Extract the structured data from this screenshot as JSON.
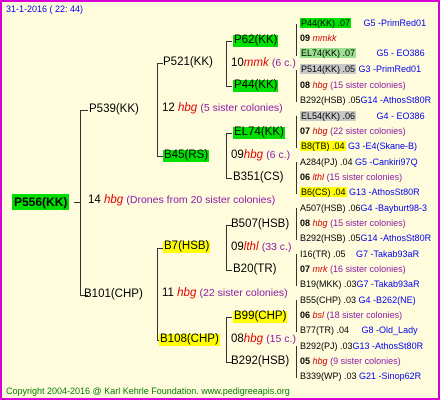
{
  "header": "31-1-2016 ( 22: 44)",
  "footer": "Copyright 2004-2016 @ Karl Kehrle Foundation.   www.pedigreeapis.org",
  "root": {
    "code": "P556(KK)",
    "num": "14",
    "breed": "hbg",
    "note": "(Drones from 20 sister colonies)"
  },
  "gen1": [
    {
      "code": "P539(KK)",
      "num": "12",
      "breed": "hbg",
      "note": "(5 sister colonies)"
    },
    {
      "code": "B101(CHP)",
      "num": "11",
      "breed": "hbg",
      "note": "(22 sister colonies)"
    }
  ],
  "gen2": [
    {
      "code": "P521(KK)",
      "num": "10",
      "breed": "mmk",
      "note": "(6 c.)"
    },
    {
      "code": "B45(RS)",
      "num": "09",
      "breed": "hbg",
      "note": "(6 c.)"
    },
    {
      "code": "B7(HSB)",
      "num": "09",
      "breed": "lthl",
      "note": "(33 c.)"
    },
    {
      "code": "B108(CHP)",
      "num": "08",
      "breed": "hbg",
      "note": "(15 c.)"
    }
  ],
  "gen3": [
    "P62(KK)",
    "P44(KK)",
    "EL74(KK)",
    "B351(CS)",
    "B507(HSB)",
    "B20(TR)",
    "B99(CHP)",
    "B292(HSB)"
  ],
  "gen4": [
    {
      "code": "P44(KK) .07",
      "ref": "G5 -PrimRed01"
    },
    {
      "num": "09",
      "breed": "mmkk",
      "note": ""
    },
    {
      "code": "EL74(KK) .07",
      "ref": "G5 - EO386"
    },
    {
      "code": "P514(KK) .05",
      "ref": "G3 -PrimRed01"
    },
    {
      "num": "08",
      "breed": "hbg",
      "note": "(15 sister colonies)"
    },
    {
      "code": "B292(HSB) .05",
      "ref": "G14 -AthosSt80R"
    },
    {
      "code": "EL54(KK) .06",
      "ref": "G4 - EO386"
    },
    {
      "num": "07",
      "breed": "hbg",
      "note": "(22 sister colonies)"
    },
    {
      "code": "B8(TB) .04",
      "ref": "G3 -E4(Skane-B)"
    },
    {
      "code": "A284(PJ) .04",
      "ref": "G5 -Cankiri97Q"
    },
    {
      "num": "06",
      "breed": "lthl",
      "note": "(15 sister colonies)"
    },
    {
      "code": "B6(CS) .04",
      "ref": "G13 -AthosSt80R"
    },
    {
      "code": "A507(HSB) .06",
      "ref": "G4 -Bayburt98-3"
    },
    {
      "num": "08",
      "breed": "hbg",
      "note": "(15 sister colonies)"
    },
    {
      "code": "B292(HSB) .05",
      "ref": "G14 -AthosSt80R"
    },
    {
      "code": "I16(TR) .05",
      "ref": "G7 -Takab93aR"
    },
    {
      "num": "07",
      "breed": "mrk",
      "note": "(16 sister colonies)"
    },
    {
      "code": "B19(MKK) .03",
      "ref": "G7 -Takab93aR"
    },
    {
      "code": "B55(CHP) .03",
      "ref": "G4 -B262(NE)"
    },
    {
      "num": "06",
      "breed": "bsl",
      "note": "(18 sister colonies)"
    },
    {
      "code": "B77(TR) .04",
      "ref": "G8 -Old_Lady"
    },
    {
      "code": "B292(PJ) .03",
      "ref": "G13 -AthosSt80R"
    },
    {
      "num": "05",
      "breed": "hbg",
      "note": "(9 sister colonies)"
    },
    {
      "code": "B339(WP) .03",
      "ref": "G21 -Sinop62R"
    }
  ]
}
